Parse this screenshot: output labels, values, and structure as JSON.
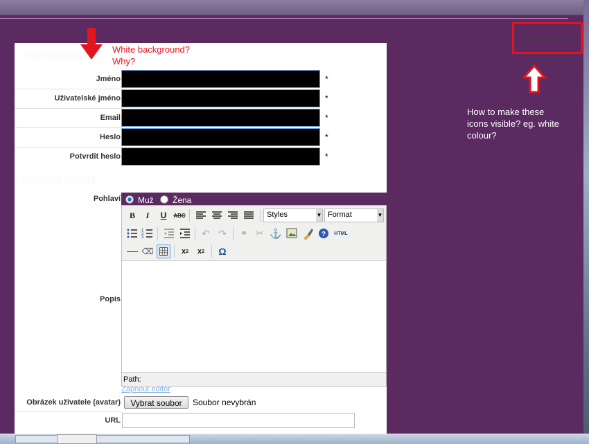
{
  "breadcrumb": {
    "home": "Home",
    "sep": "»",
    "current": "Nový"
  },
  "annotations": {
    "top_line1": "White background?",
    "top_line2": "Why?",
    "right_note": "How to make these icons visible? eg. white colour?"
  },
  "sections": {
    "account": "Podrobnosti ú",
    "personal": "Osobní údaje"
  },
  "account_fields": [
    {
      "label": "Jméno",
      "required": "*"
    },
    {
      "label": "Uživatelské jméno",
      "required": "*"
    },
    {
      "label": "Email",
      "required": "*"
    },
    {
      "label": "Heslo",
      "required": "*"
    },
    {
      "label": "Potvrdit heslo",
      "required": "*"
    }
  ],
  "gender": {
    "label": "Pohlaví",
    "options": [
      "Muž",
      "Žena"
    ],
    "selected": "Muž"
  },
  "description": {
    "label": "Popis",
    "styles_select": "Styles",
    "format_select": "Format",
    "status_path": "Path:",
    "toggle_link": "Zapnout editor"
  },
  "avatar": {
    "label": "Obrázek uživatele (avatar)",
    "button": "Vybrat soubor",
    "status": "Soubor nevybrán"
  },
  "url": {
    "label": "URL",
    "value": ""
  },
  "colors": {
    "background": "#5a2a60",
    "annotation_red": "#e2141c",
    "field_border": "#6d9fd9"
  }
}
